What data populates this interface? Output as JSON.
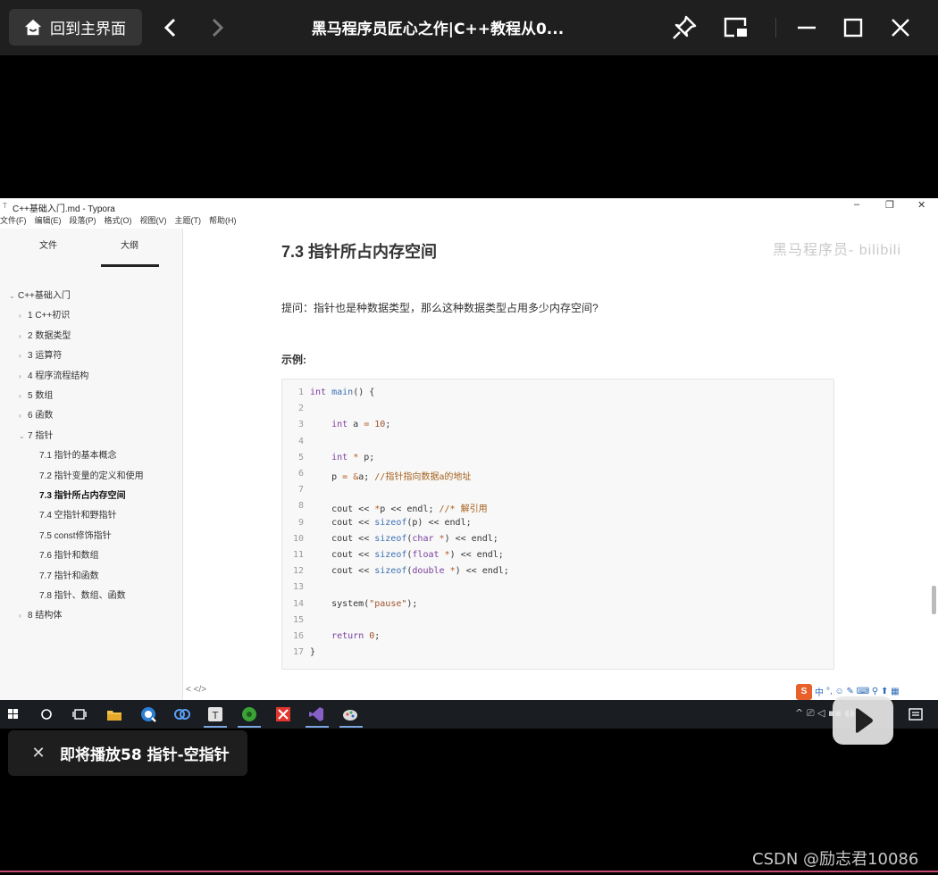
{
  "player": {
    "home_label": "回到主界面",
    "title": "黑马程序员匠心之作|C++教程从0..."
  },
  "typora": {
    "window_title": "C++基础入门.md - Typora",
    "menu": [
      "文件(F)",
      "编辑(E)",
      "段落(P)",
      "格式(O)",
      "视图(V)",
      "主题(T)",
      "帮助(H)"
    ],
    "sidebar_tabs": [
      "文件",
      "大纲"
    ],
    "outline": [
      {
        "label": "C++基础入门",
        "level": 0,
        "chevron": "open"
      },
      {
        "label": "1 C++初识",
        "level": 1,
        "chevron": "closed"
      },
      {
        "label": "2 数据类型",
        "level": 1,
        "chevron": "closed"
      },
      {
        "label": "3 运算符",
        "level": 1,
        "chevron": "closed"
      },
      {
        "label": "4 程序流程结构",
        "level": 1,
        "chevron": "closed"
      },
      {
        "label": "5 数组",
        "level": 1,
        "chevron": "closed"
      },
      {
        "label": "6 函数",
        "level": 1,
        "chevron": "closed"
      },
      {
        "label": "7 指针",
        "level": 1,
        "chevron": "open"
      },
      {
        "label": "7.1 指针的基本概念",
        "level": 2,
        "chevron": ""
      },
      {
        "label": "7.2 指针变量的定义和使用",
        "level": 2,
        "chevron": ""
      },
      {
        "label": "7.3 指针所占内存空间",
        "level": 2,
        "chevron": "",
        "active": true
      },
      {
        "label": "7.4 空指针和野指针",
        "level": 2,
        "chevron": ""
      },
      {
        "label": "7.5 const修饰指针",
        "level": 2,
        "chevron": ""
      },
      {
        "label": "7.6 指针和数组",
        "level": 2,
        "chevron": ""
      },
      {
        "label": "7.7 指针和函数",
        "level": 2,
        "chevron": ""
      },
      {
        "label": "7.8 指针、数组、函数",
        "level": 2,
        "chevron": ""
      },
      {
        "label": "8 结构体",
        "level": 1,
        "chevron": "closed"
      }
    ],
    "heading": "7.3 指针所占内存空间",
    "tip": "提问：指针也是种数据类型，那么这种数据类型占用多少内存空间?",
    "example_label": "示例:",
    "code_lines": [
      {
        "n": "1",
        "code": "int main() {"
      },
      {
        "n": "2",
        "code": ""
      },
      {
        "n": "3",
        "code": "    int a = 10;"
      },
      {
        "n": "4",
        "code": ""
      },
      {
        "n": "5",
        "code": "    int * p;"
      },
      {
        "n": "6",
        "code": "    p = &a; //指针指向数据a的地址"
      },
      {
        "n": "7",
        "code": ""
      },
      {
        "n": "8",
        "code": "    cout << *p << endl; //* 解引用"
      },
      {
        "n": "9",
        "code": "    cout << sizeof(p) << endl;"
      },
      {
        "n": "10",
        "code": "    cout << sizeof(char *) << endl;"
      },
      {
        "n": "11",
        "code": "    cout << sizeof(float *) << endl;"
      },
      {
        "n": "12",
        "code": "    cout << sizeof(double *) << endl;"
      },
      {
        "n": "13",
        "code": ""
      },
      {
        "n": "14",
        "code": "    system(\"pause\");"
      },
      {
        "n": "15",
        "code": ""
      },
      {
        "n": "16",
        "code": "    return 0;"
      },
      {
        "n": "17",
        "code": "}"
      }
    ],
    "watermark": "黑马程序员- bilibili",
    "footer_icons": "<  </>"
  },
  "ime": {
    "brand": "S",
    "lang": "中"
  },
  "toast": {
    "text": "即将播放58 指针-空指针"
  },
  "csdn_watermark": "CSDN @励志君10086",
  "colors": {
    "topbar": "#1f1f1f",
    "accent_line": "#c74a72",
    "taskbar": "#1a1d22"
  }
}
